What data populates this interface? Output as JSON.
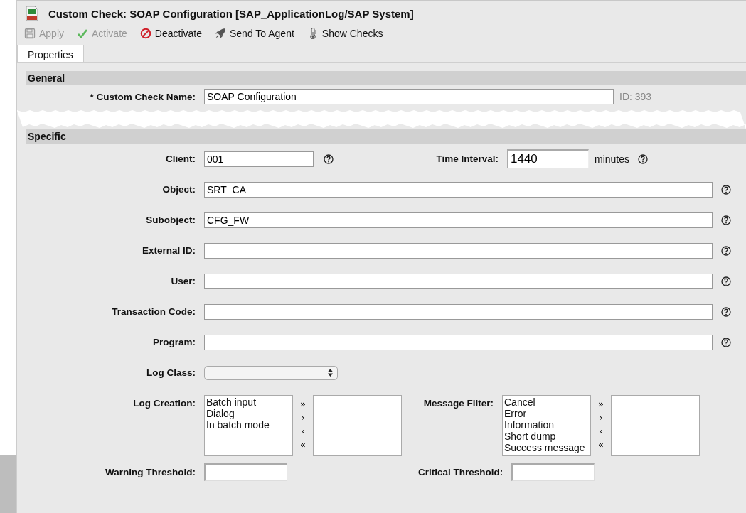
{
  "window": {
    "title": "Custom Check: SOAP Configuration [SAP_ApplicationLog/SAP System]"
  },
  "toolbar": [
    {
      "kind": "save",
      "label": "Apply",
      "disabled": true
    },
    {
      "kind": "check",
      "label": "Activate",
      "disabled": true
    },
    {
      "kind": "block",
      "label": "Deactivate",
      "disabled": false
    },
    {
      "kind": "rocket",
      "label": "Send To Agent",
      "disabled": false
    },
    {
      "kind": "thermometer",
      "label": "Show Checks",
      "disabled": false
    }
  ],
  "tabs": [
    {
      "label": "Properties",
      "selected": true
    }
  ],
  "general": {
    "title": "General",
    "name_label": "* Custom Check Name:",
    "name_value": "SOAP Configuration",
    "id_text": "ID: 393"
  },
  "specific": {
    "title": "Specific",
    "rows": [
      {
        "kind": "pair",
        "label": "Client:",
        "value": "001",
        "help": true,
        "label2": "Time Interval:",
        "value2": "1440",
        "unit": "minutes",
        "help2": true
      },
      {
        "kind": "wide",
        "label": "Object:",
        "value": "SRT_CA",
        "help": true
      },
      {
        "kind": "wide",
        "label": "Subobject:",
        "value": "CFG_FW",
        "help": true
      },
      {
        "kind": "wide",
        "label": "External ID:",
        "help": true
      },
      {
        "kind": "wide",
        "label": "User:",
        "help": true
      },
      {
        "kind": "wide",
        "label": "Transaction Code:",
        "help": true
      },
      {
        "kind": "wide",
        "label": "Program:",
        "help": true
      },
      {
        "kind": "select",
        "label": "Log Class:"
      },
      {
        "kind": "lists",
        "label": "Log Creation:",
        "items": [
          "Batch input",
          "Dialog",
          "In batch mode"
        ],
        "label2": "Message Filter:",
        "items2": [
          "Cancel",
          "Error",
          "Information",
          "Short dump",
          "Success message"
        ],
        "buttons": [
          "»",
          "›",
          "‹",
          "«"
        ]
      },
      {
        "kind": "thresholds",
        "label": "Warning Threshold:",
        "label2": "Critical Threshold:"
      }
    ]
  }
}
